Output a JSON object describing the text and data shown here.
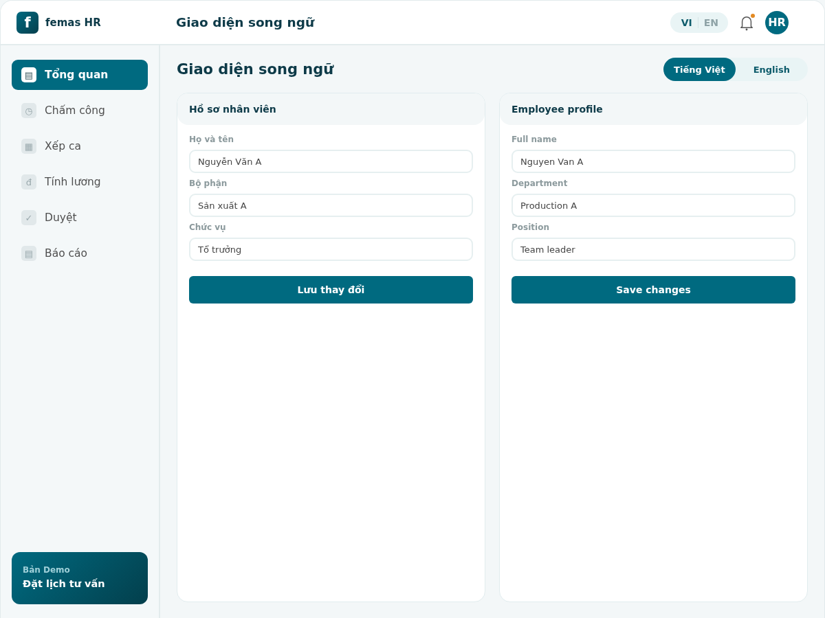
{
  "app": {
    "logo_letter": "f",
    "name": "femas HR"
  },
  "header": {
    "title": "Giao diện song ngữ",
    "language_switch": [
      {
        "label": "VI",
        "selected": true
      },
      {
        "label": "EN",
        "selected": false
      }
    ],
    "notifications": {
      "unread": true
    },
    "avatar": "HR"
  },
  "sidebar": {
    "items": [
      {
        "icon": "▤",
        "label": "Tổng quan",
        "selected": true
      },
      {
        "icon": "◷",
        "label": "Chấm công",
        "selected": false
      },
      {
        "icon": "▦",
        "label": "Xếp ca",
        "selected": false
      },
      {
        "icon": "đ",
        "label": "Tính lương",
        "selected": false
      },
      {
        "icon": "✓",
        "label": "Duyệt",
        "selected": false
      },
      {
        "icon": "▤",
        "label": "Báo cáo",
        "selected": false
      }
    ],
    "promo": {
      "label": "Bản Demo",
      "link": "Đặt lịch tư vấn"
    }
  },
  "page": {
    "title": "Giao diện song ngữ",
    "language_tabs": [
      {
        "label": "Tiếng Việt",
        "selected": true
      },
      {
        "label": "English",
        "selected": false
      }
    ]
  },
  "forms": [
    {
      "title": "Hồ sơ nhân viên",
      "fields": [
        {
          "label": "Họ và tên",
          "value": "Nguyễn Văn A"
        },
        {
          "label": "Bộ phận",
          "value": "Sản xuất A"
        },
        {
          "label": "Chức vụ",
          "value": "Tổ trưởng"
        }
      ],
      "button": "Lưu thay đổi"
    },
    {
      "title": "Employee profile",
      "fields": [
        {
          "label": "Full name",
          "value": "Nguyen Van A"
        },
        {
          "label": "Department",
          "value": "Production A"
        },
        {
          "label": "Position",
          "value": "Team leader"
        }
      ],
      "button": "Save changes"
    }
  ]
}
